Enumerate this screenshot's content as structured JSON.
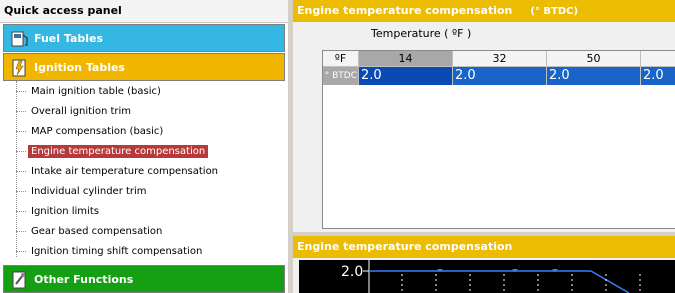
{
  "left_panel": {
    "title": "Quick access panel",
    "groups": {
      "fuel": "Fuel Tables",
      "ignition": "Ignition Tables",
      "other": "Other Functions"
    },
    "ignition_items": [
      "Main ignition table (basic)",
      "Overall ignition trim",
      "MAP compensation (basic)",
      "Engine temperature compensation",
      "Intake air temperature compensation",
      "Individual cylinder trim",
      "Ignition limits",
      "Gear based compensation",
      "Ignition timing shift compensation"
    ],
    "selected_item": "Engine temperature compensation"
  },
  "table_panel": {
    "title": "Engine temperature compensation",
    "unit": "(° BTDC)",
    "axis_label": "Temperature   ( ºF )",
    "corner": "ºF",
    "row_label": "° BTDC",
    "columns": [
      "14",
      "32",
      "50",
      ""
    ],
    "values": [
      "2.0",
      "2.0",
      "2.0",
      "2.0"
    ]
  },
  "chart_panel": {
    "title": "Engine temperature compensation",
    "y_tick": "2.0"
  },
  "colors": {
    "fuel": "#35b7e4",
    "ignition": "#f1b700",
    "other": "#15a014",
    "header": "#ecbc00",
    "selected": "#b63a3a",
    "cell": "#1a64c8"
  }
}
